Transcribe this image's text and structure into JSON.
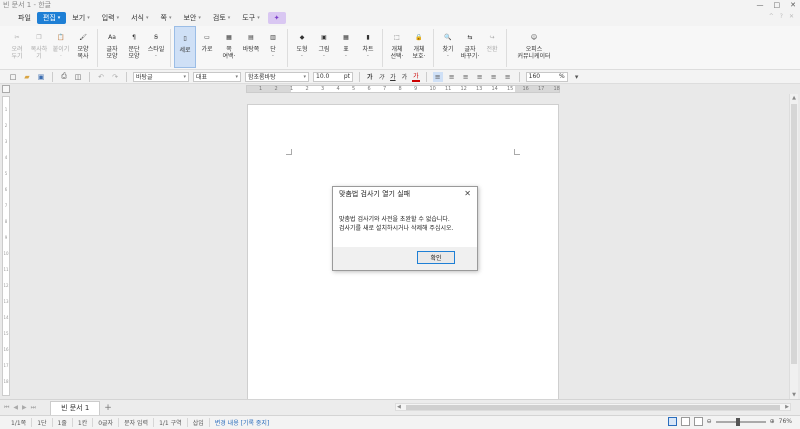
{
  "window": {
    "title": "빈 문서 1 - 한글",
    "controls": [
      "—",
      "□",
      "✕"
    ]
  },
  "menubar": {
    "file": "파일",
    "items": [
      {
        "label": "편집",
        "active": true
      },
      {
        "label": "보기"
      },
      {
        "label": "입력"
      },
      {
        "label": "서식"
      },
      {
        "label": "쪽"
      },
      {
        "label": "보안"
      },
      {
        "label": "검토"
      },
      {
        "label": "도구"
      }
    ],
    "right": [
      "^",
      "?",
      "✕"
    ]
  },
  "ribbon": {
    "buttons": [
      {
        "icon": "scissors-icon",
        "label": "오려\n두기",
        "disabled": true
      },
      {
        "icon": "copy-icon",
        "label": "복사하기",
        "disabled": true
      },
      {
        "icon": "paste-icon",
        "label": "붙이기\n·",
        "disabled": true
      },
      {
        "icon": "format-painter-icon",
        "label": "모양\n복사",
        "disabled": false
      },
      {
        "icon": "char-shape-icon",
        "label": "글자\n모양",
        "disabled": false
      },
      {
        "icon": "para-shape-icon",
        "label": "문단\n모양",
        "disabled": false
      },
      {
        "icon": "style-icon",
        "label": "스타일\n·",
        "disabled": false
      },
      {
        "icon": "portrait-icon",
        "label": "세로",
        "disabled": false,
        "selected": true
      },
      {
        "icon": "landscape-icon",
        "label": "가로",
        "disabled": false
      },
      {
        "icon": "margin-icon",
        "label": "쪽\n여백·",
        "disabled": false
      },
      {
        "icon": "page-bg-icon",
        "label": "바탕쪽",
        "disabled": false
      },
      {
        "icon": "column-icon",
        "label": "단\n·",
        "disabled": false
      },
      {
        "icon": "shape-icon",
        "label": "도형\n·",
        "disabled": false
      },
      {
        "icon": "picture-icon",
        "label": "그림\n·",
        "disabled": false
      },
      {
        "icon": "table-icon",
        "label": "표\n·",
        "disabled": false
      },
      {
        "icon": "chart-icon",
        "label": "차트\n·",
        "disabled": false
      },
      {
        "icon": "object-select-icon",
        "label": "개체\n선택·",
        "disabled": false
      },
      {
        "icon": "object-protect-icon",
        "label": "개체\n보호·",
        "disabled": false
      },
      {
        "icon": "find-icon",
        "label": "찾기\n·",
        "disabled": false
      },
      {
        "icon": "replace-icon",
        "label": "글자\n바꾸기·",
        "disabled": false
      },
      {
        "icon": "goto-icon",
        "label": "전환",
        "disabled": true
      },
      {
        "icon": "office-community-icon",
        "label": "오피스\n커뮤니케이터",
        "disabled": false,
        "wide": true
      }
    ]
  },
  "toolbar2": {
    "style_combo": "바탕글",
    "lang_combo": "대표",
    "font_combo": "함초롬바탕",
    "size_value": "10.0",
    "size_unit": "pt",
    "format_buttons": [
      "가",
      "가",
      "가",
      "가",
      "가"
    ],
    "zoom_value": "160",
    "zoom_unit": "%"
  },
  "ruler": {
    "ticks": [
      "1",
      "2",
      "1",
      "2",
      "3",
      "4",
      "5",
      "6",
      "7",
      "8",
      "9",
      "10",
      "11",
      "12",
      "13",
      "14",
      "15",
      "16",
      "17",
      "18"
    ],
    "vticks": [
      "1",
      "2",
      "3",
      "4",
      "5",
      "6",
      "7",
      "8",
      "9",
      "10",
      "11",
      "12",
      "13",
      "14",
      "15",
      "16",
      "17",
      "18"
    ]
  },
  "dialog": {
    "title": "맞춤법 검사기 열기 실패",
    "close": "✕",
    "line1": "맞춤법 검사기와 사전을 초완할 수 없습니다.",
    "line2": "검사기를 새로 설치하시거나 삭제해 주십시오.",
    "ok": "확인"
  },
  "tabs": {
    "doc": "빈 문서 1",
    "add": "+"
  },
  "status": {
    "items": [
      "1/1쪽",
      "1단",
      "1줄",
      "1칸",
      "0글자",
      "문자 입력",
      "1/1 구역",
      "삽입"
    ],
    "change": "변경 내용 [기록 중지]",
    "zoom": "76%"
  }
}
